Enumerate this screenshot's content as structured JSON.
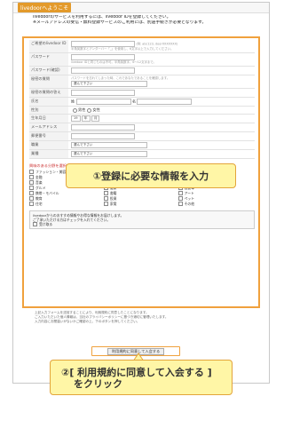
{
  "header": {
    "logo": "livedoorへようこそ"
  },
  "intro": [
    "livedoorのサービスを利用するには、livedoor IDを登録してください。",
    "※メールアドレスの受信・無料登録サービスのご利用には、別途手続きが必要となります。"
  ],
  "form": {
    "rows": [
      {
        "label": "ご希望のlivedoor ID",
        "placeholder": "(例: abc123, doorXXXXXXX)",
        "hint": "半角英数字とアンダーバー「_」を使用し、6文字以上で入力してください。"
      },
      {
        "label": "パスワード",
        "placeholder": "",
        "hint": "livedoor IDと同じものは不可。半角英数字、6〜12文字まで。"
      },
      {
        "label": "パスワード(確認)",
        "placeholder": "",
        "hint": ""
      },
      {
        "label": "秘密の質問",
        "select": "選んで下さい",
        "hint": "パスワードを忘れてしまった時、これであなたであることを確認します。"
      },
      {
        "label": "秘密の質問の答え",
        "placeholder": "",
        "hint": ""
      },
      {
        "label": "氏名",
        "first_label": "姓",
        "last_label": "名"
      },
      {
        "label": "性別",
        "options": [
          "男性",
          "女性"
        ]
      },
      {
        "label": "生年月日",
        "year": "19",
        "month": "年",
        "day": "月"
      },
      {
        "label": "メールアドレス",
        "placeholder": "",
        "hint": ""
      },
      {
        "label": "郵便番号",
        "placeholder": "",
        "hint": ""
      },
      {
        "label": "職業",
        "select": "選んで下さい"
      },
      {
        "label": "業種",
        "select": "選んで下さい"
      }
    ]
  },
  "interests": {
    "title": "興味のある分野を選択してください",
    "items": [
      "ファッション・美容",
      "ノートパソコン",
      "インターネット",
      "金融",
      "旅行",
      "スポーツ",
      "音楽",
      "映画",
      "ゲーム",
      "グルメ",
      "健康",
      "自動車",
      "携帯・モバイル",
      "書籍",
      "アート",
      "教育",
      "投資",
      "ペット",
      "住宅",
      "家電",
      "その他"
    ]
  },
  "mail_box": {
    "line1": "livedoorからのおすすめ情報やお得な情報をお届けします。",
    "line2": "ご了承いただける方はチェックを入れてください。",
    "checkbox_label": "受け取る"
  },
  "terms": [
    "上記入力フォームを送信することにより、利用規約に同意したことになります。",
    "ご入力いただいた個人情報は、当社のプライバシーポリシーに基づき適切に管理いたします。",
    "入力内容にお間違いがないかご確認の上、下のボタンを押してください。"
  ],
  "submit_label": "利用規約に同意して入会する",
  "callouts": {
    "step1": "①登録に必要な情報を入力",
    "step2_line1": "②[ 利用規約に同意して入会する ]",
    "step2_line2": "をクリック"
  }
}
